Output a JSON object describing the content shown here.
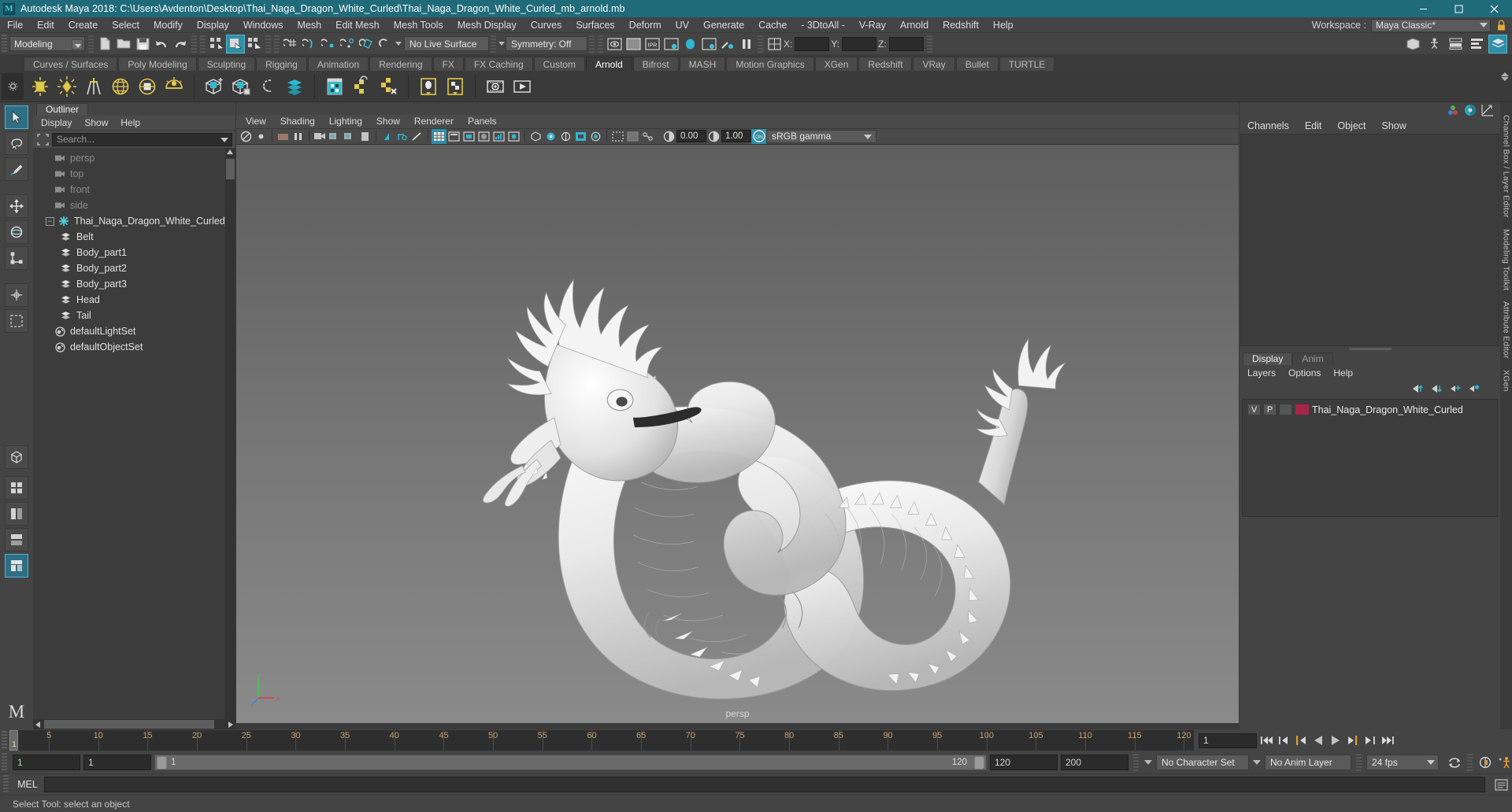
{
  "window": {
    "title": "Autodesk Maya 2018: C:\\Users\\Avdenton\\Desktop\\Thai_Naga_Dragon_White_Curled\\Thai_Naga_Dragon_White_Curled_mb_arnold.mb",
    "logo_letter": "M",
    "minimize": "minimize-button",
    "maximize": "maximize-button",
    "close": "close-button"
  },
  "menubar": {
    "items": [
      "File",
      "Edit",
      "Create",
      "Select",
      "Modify",
      "Display",
      "Windows",
      "Mesh",
      "Edit Mesh",
      "Mesh Tools",
      "Mesh Display",
      "Curves",
      "Surfaces",
      "Deform",
      "UV",
      "Generate",
      "Cache",
      "- 3DtoAll -",
      "V-Ray",
      "Arnold",
      "Redshift",
      "Help"
    ],
    "workspace_label": "Workspace :",
    "workspace_value": "Maya Classic*"
  },
  "statusline": {
    "menuset": "Modeling",
    "live_surface": "No Live Surface",
    "symmetry": "Symmetry: Off",
    "coord_x_label": "X:",
    "coord_y_label": "Y:",
    "coord_z_label": "Z:",
    "coord_x_value": "",
    "coord_y_value": "",
    "coord_z_value": ""
  },
  "shelf": {
    "tabs": [
      "Curves / Surfaces",
      "Poly Modeling",
      "Sculpting",
      "Rigging",
      "Animation",
      "Rendering",
      "FX",
      "FX Caching",
      "Custom",
      "Arnold",
      "Bifrost",
      "MASH",
      "Motion Graphics",
      "XGen",
      "Redshift",
      "VRay",
      "Bullet",
      "TURTLE"
    ],
    "active_tab": "Arnold",
    "icons": [
      "arnold-area-light-icon",
      "arnold-point-light-icon",
      "arnold-directional-light-icon",
      "arnold-skydome-light-icon",
      "arnold-mesh-light-icon",
      "arnold-photometric-light-icon",
      "arnold-create-volume-icon",
      "arnold-standin-icon",
      "arnold-curve-collector-icon",
      "arnold-bifrost-icon",
      "arnold-render-view-icon",
      "arnold-flare-icon",
      "arnold-remove-icon",
      "arnold-light-manager-icon",
      "arnold-tx-manager-icon",
      "arnold-open-render-view-icon",
      "arnold-render-sequence-icon"
    ]
  },
  "outliner": {
    "tab": "Outliner",
    "menu": [
      "Display",
      "Show",
      "Help"
    ],
    "search_placeholder": "Search...",
    "items": [
      {
        "label": "persp",
        "type": "camera",
        "indent": 2,
        "dim": true
      },
      {
        "label": "top",
        "type": "camera",
        "indent": 2,
        "dim": true
      },
      {
        "label": "front",
        "type": "camera",
        "indent": 2,
        "dim": true
      },
      {
        "label": "side",
        "type": "camera",
        "indent": 2,
        "dim": true
      },
      {
        "label": "Thai_Naga_Dragon_White_Curled_",
        "type": "group",
        "indent": 1,
        "dim": false,
        "expanded": true
      },
      {
        "label": "Belt",
        "type": "mesh",
        "indent": 3,
        "dim": false
      },
      {
        "label": "Body_part1",
        "type": "mesh",
        "indent": 3,
        "dim": false
      },
      {
        "label": "Body_part2",
        "type": "mesh",
        "indent": 3,
        "dim": false
      },
      {
        "label": "Body_part3",
        "type": "mesh",
        "indent": 3,
        "dim": false
      },
      {
        "label": "Head",
        "type": "mesh",
        "indent": 3,
        "dim": false
      },
      {
        "label": "Tail",
        "type": "mesh",
        "indent": 3,
        "dim": false
      },
      {
        "label": "defaultLightSet",
        "type": "set",
        "indent": 2,
        "dim": false
      },
      {
        "label": "defaultObjectSet",
        "type": "set",
        "indent": 2,
        "dim": false
      }
    ]
  },
  "viewport": {
    "menu": [
      "View",
      "Shading",
      "Lighting",
      "Show",
      "Renderer",
      "Panels"
    ],
    "exposure": "0.00",
    "gamma": "1.00",
    "color_space": "sRGB gamma",
    "camera_label": "persp",
    "axis": {
      "x": "x",
      "y": "y",
      "z": "z"
    }
  },
  "channelbox": {
    "menu": [
      "Channels",
      "Edit",
      "Object",
      "Show"
    ],
    "icons": [
      "channel-box-icon",
      "attribute-editor-icon",
      "graph-editor-icon"
    ]
  },
  "layers": {
    "tabs": [
      "Display",
      "Anim"
    ],
    "active_tab": "Display",
    "menu": [
      "Layers",
      "Options",
      "Help"
    ],
    "toolbar_icons": [
      "move-layer-up-icon",
      "move-layer-down-icon",
      "new-layer-icon",
      "new-layer-from-selected-icon"
    ],
    "rows": [
      {
        "visibility": "V",
        "playback": "P",
        "state": "",
        "color": "#a8254a",
        "name": "Thai_Naga_Dragon_White_Curled"
      }
    ]
  },
  "right_tabs": [
    "Channel Box / Layer Editor",
    "Modeling Toolkit",
    "Attribute Editor",
    "XGen"
  ],
  "timeslider": {
    "start_visible": "1",
    "ticks": [
      5,
      10,
      15,
      20,
      25,
      30,
      35,
      40,
      45,
      50,
      55,
      60,
      65,
      70,
      75,
      80,
      85,
      90,
      95,
      100,
      105,
      110,
      115,
      120
    ],
    "end_label": "120",
    "current_frame": "1",
    "current_field": "1",
    "playback_buttons": [
      "go-to-start-icon",
      "step-back-keyframe-icon",
      "step-back-frame-icon",
      "play-backwards-icon",
      "play-forwards-icon",
      "step-forward-frame-icon",
      "step-forward-keyframe-icon",
      "go-to-end-icon"
    ]
  },
  "rangeslider": {
    "anim_start": "1",
    "range_start": "1",
    "bar_start_label": "1",
    "bar_end_label": "120",
    "range_end": "120",
    "anim_end": "200",
    "character_set": "No Character Set",
    "anim_layer": "No Anim Layer",
    "fps": "24 fps",
    "icons": [
      "auto-keyframe-icon",
      "animation-preferences-icon",
      "loop-icon"
    ]
  },
  "command_line": {
    "language_label": "MEL",
    "input_value": "",
    "script-editor-icon": "script-editor-icon"
  },
  "helpline": {
    "message": "Select Tool: select an object"
  },
  "toolbox": {
    "tools": [
      "select-tool",
      "lasso-select-tool",
      "paint-select-tool",
      "move-tool",
      "rotate-tool",
      "scale-tool",
      "show-manipulator-tool",
      "last-tool-used",
      "single-perspective-view",
      "four-view-layout",
      "persp-outliner-layout",
      "persp-graph-layout",
      "hypershade-layout"
    ],
    "selected": "select-tool",
    "logo": "maya-logo-icon"
  },
  "colors": {
    "title_bar": "#1f6b7a",
    "accent": "#2f8fa8",
    "panel_bg": "#444444",
    "list_bg": "#3c3c3c",
    "layer_color": "#a8254a",
    "tick_text": "#c5a173"
  }
}
